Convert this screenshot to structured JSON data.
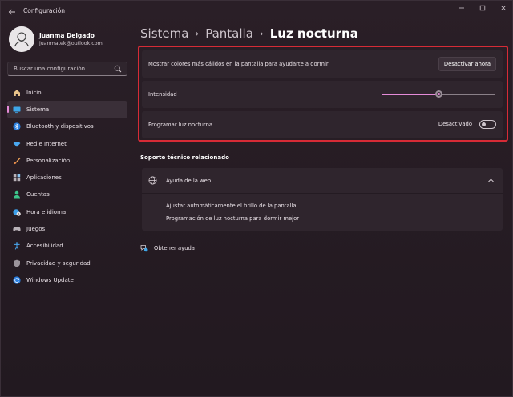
{
  "window": {
    "title": "Configuración"
  },
  "profile": {
    "name": "Juanma Delgado",
    "email": "juanmatek@outlook.com"
  },
  "search": {
    "placeholder": "Buscar una configuración"
  },
  "nav": {
    "items": [
      {
        "label": "Inicio",
        "icon": "home-icon"
      },
      {
        "label": "Sistema",
        "icon": "display-icon",
        "active": true
      },
      {
        "label": "Bluetooth y dispositivos",
        "icon": "bluetooth-icon"
      },
      {
        "label": "Red e Internet",
        "icon": "wifi-icon"
      },
      {
        "label": "Personalización",
        "icon": "brush-icon"
      },
      {
        "label": "Aplicaciones",
        "icon": "apps-icon"
      },
      {
        "label": "Cuentas",
        "icon": "person-icon"
      },
      {
        "label": "Hora e idioma",
        "icon": "globe-clock-icon"
      },
      {
        "label": "Juegos",
        "icon": "gamepad-icon"
      },
      {
        "label": "Accesibilidad",
        "icon": "accessibility-icon"
      },
      {
        "label": "Privacidad y seguridad",
        "icon": "shield-icon"
      },
      {
        "label": "Windows Update",
        "icon": "update-icon"
      }
    ]
  },
  "breadcrumb": {
    "level1": "Sistema",
    "level2": "Pantalla",
    "current": "Luz nocturna",
    "separator": "›"
  },
  "settings": {
    "warm_colors": {
      "label": "Mostrar colores más cálidos en la pantalla para ayudarte a dormir",
      "button": "Desactivar ahora"
    },
    "intensity": {
      "label": "Intensidad",
      "value": 0.5
    },
    "schedule": {
      "label": "Programar luz nocturna",
      "state_label": "Desactivado",
      "on": false
    }
  },
  "support": {
    "title": "Soporte técnico relacionado",
    "web_help": {
      "title": "Ayuda de la web",
      "links": [
        "Ajustar automáticamente el brillo de la pantalla",
        "Programación de luz nocturna para dormir mejor"
      ]
    }
  },
  "get_help": {
    "label": "Obtener ayuda"
  },
  "colors": {
    "accent": "#e58bd8",
    "highlight_border": "#d62b36",
    "card_bg": "#2f252d"
  }
}
